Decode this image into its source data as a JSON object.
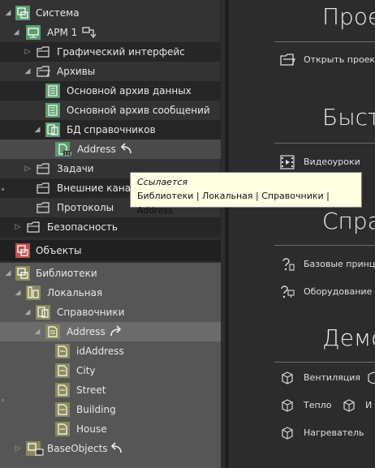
{
  "tree": {
    "sistema": "Система",
    "arm1": "АРМ 1",
    "graphic_ui": "Графический интерфейс",
    "archives": "Архивы",
    "main_data_archive": "Основной архив данных",
    "main_msg_archive": "Основной архив сообщений",
    "bd_ref": "БД справочников",
    "address": "Address",
    "tasks": "Задачи",
    "external_channels": "Внешние канал",
    "protocols": "Протоколы",
    "security": "Безопасность",
    "objects": "Объекты",
    "libraries": "Библиотеки",
    "local": "Локальная",
    "reference": "Справочники",
    "lib_address": "Address",
    "fields": [
      "idAddress",
      "City",
      "Street",
      "Building",
      "House"
    ],
    "base_objects": "BaseObjects"
  },
  "tooltip": {
    "title": "Ссылается",
    "path": "Библиотеки | Локальная | Справочники | Address"
  },
  "right": {
    "sec1": "Прое",
    "open_project": "Открыть проект",
    "sec2": "Быст",
    "video": "Видеоуроки",
    "sec3": "Спра",
    "basic_principles": "Базовые принц",
    "equipment": "Оборудование",
    "sec4": "Демо",
    "ventilation": "Вентиляция",
    "heat": "Тепло",
    "heater": "Нагреватель",
    "heat_extra": "И"
  },
  "colors": {
    "green_icon": "#5a9e6e",
    "red_icon": "#c0504d",
    "olive_icon": "#8a8a5a",
    "tooltip_bg": "#ffffe1"
  }
}
